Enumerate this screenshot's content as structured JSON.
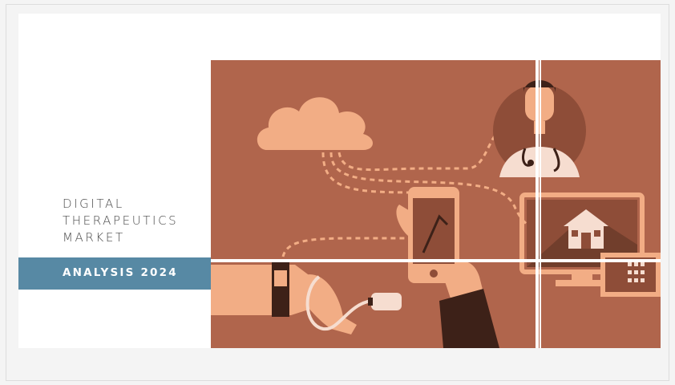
{
  "slide": {
    "title_lines": [
      "DIGITAL",
      "THERAPEUTICS",
      "MARKET"
    ],
    "banner_label": "ANALYSIS 2024"
  },
  "illustration": {
    "subject": "digital health network illustration",
    "icons": [
      "cloud-icon",
      "doctor-icon",
      "smartphone-icon",
      "monitor-icon",
      "house-icon",
      "smartwatch-icon",
      "usb-plug-icon",
      "calculator-icon"
    ]
  },
  "colors": {
    "banner": "#5789a4",
    "art_background": "#b0654c",
    "art_light": "#f2ad85",
    "art_dark": "#3d2118"
  }
}
